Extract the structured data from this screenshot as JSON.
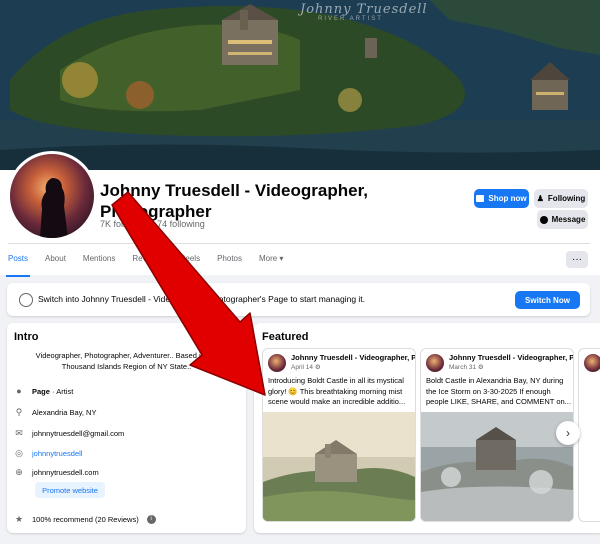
{
  "cover": {
    "watermark": "Johnny Truesdell",
    "watermark_sub": "RIVER ARTIST"
  },
  "profile": {
    "name": "Johnny Truesdell - Videographer, Photographer",
    "followers": "7K followers • 74 following"
  },
  "actions": {
    "shop": "Shop now",
    "follow": "Following",
    "message": "Message"
  },
  "tabs": [
    "Posts",
    "About",
    "Mentions",
    "Reviews",
    "Reels",
    "Photos",
    "More ▾"
  ],
  "more_dots": "···",
  "switch": {
    "text": "Switch into Johnny Truesdell - Videographer, Photographer's Page to start managing it.",
    "button": "Switch Now"
  },
  "intro": {
    "title": "Intro",
    "bio": "Videographer, Photographer, Adventurer.. Based in the Thousand Islands Region of NY State..",
    "page_label": "Page",
    "page_type": " · Artist",
    "location": "Alexandria Bay, NY",
    "email": "johnnytruesdell@gmail.com",
    "instagram": "johnnytruesdell",
    "website": "johnnytruesdell.com",
    "promote": "Promote website",
    "recommend": "100% recommend (20 Reviews)",
    "info_glyph": "i"
  },
  "featured": {
    "title": "Featured",
    "next_icon": "›",
    "cards": [
      {
        "author": "Johnny Truesdell - Videographer, Photographer",
        "date": "April 14 ⚙",
        "text": "Introducing Boldt Castle in all its mystical glory! 😊 This breathtaking morning mist scene would make an incredible additio..."
      },
      {
        "author": "Johnny Truesdell - Videographer, Photographer",
        "date": "March 31 ⚙",
        "text": "Boldt Castle in Alexandria Bay, NY during the Ice Storm on 3-30-2025 If enough people LIKE, SHARE, and COMMENT on..."
      }
    ]
  },
  "colors": {
    "accent": "#1877f2",
    "arrow": "#e00000"
  }
}
